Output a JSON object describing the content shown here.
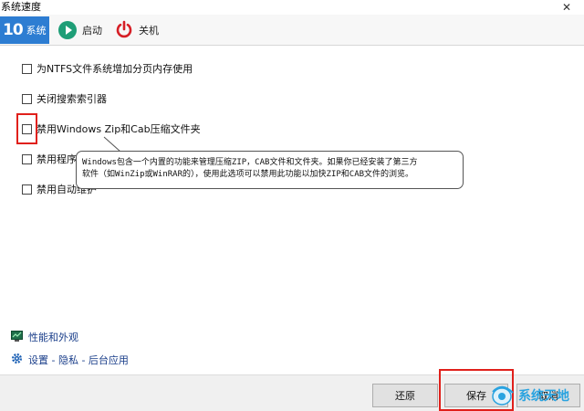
{
  "window": {
    "title": "系统速度",
    "close_glyph": "✕"
  },
  "tabs": [
    {
      "logo": "10",
      "label": "系统",
      "active": true
    },
    {
      "label": "启动",
      "icon": "play-icon"
    },
    {
      "label": "关机",
      "icon": "power-icon"
    }
  ],
  "options": [
    {
      "label": "为NTFS文件系统增加分页内存使用",
      "checked": false
    },
    {
      "label": "关闭搜索索引器",
      "checked": false
    },
    {
      "label": "禁用Windows Zip和Cab压缩文件夹",
      "checked": false
    },
    {
      "label": "禁用程序",
      "checked": false
    },
    {
      "label": "禁用自动维护",
      "checked": false
    }
  ],
  "tooltip": {
    "line1": "Windows包含一个内置的功能来管理压缩ZIP，CAB文件和文件夹。如果你已经安装了第三方",
    "line2": "软件（如WinZip或WinRAR的），使用此选项可以禁用此功能以加快ZIP和CAB文件的浏览。"
  },
  "links": [
    {
      "label": "性能和外观",
      "icon": "performance-icon"
    },
    {
      "label": "设置 - 隐私 - 后台应用",
      "icon": "gear-icon"
    }
  ],
  "buttons": {
    "restore": "还原",
    "save": "保存",
    "cancel": "取消"
  },
  "watermark": {
    "text": "系统天地"
  },
  "colors": {
    "accent": "#2d7dd2",
    "highlight": "#e0201b",
    "link": "#1a3e8a"
  }
}
